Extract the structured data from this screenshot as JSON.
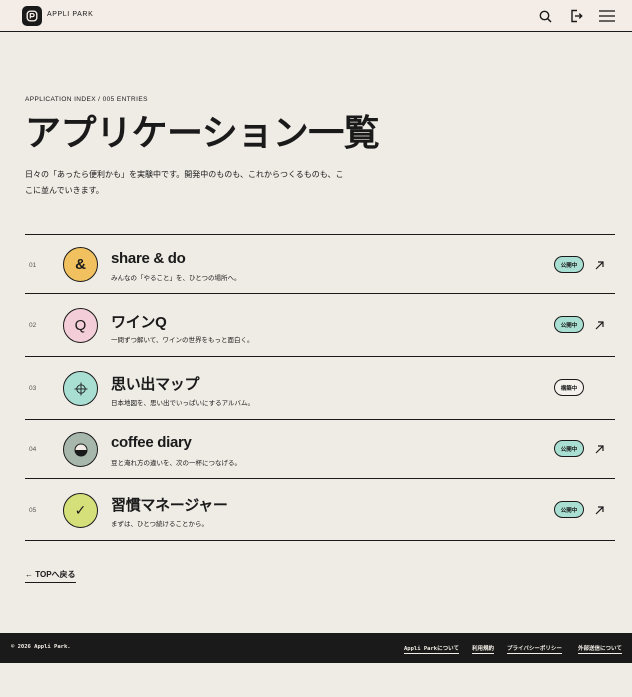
{
  "header": {
    "brand": "APPLI PARK",
    "icons": [
      "search-icon",
      "logout-icon",
      "menu-icon"
    ]
  },
  "hero": {
    "eyebrow": "APPLICATION INDEX / 005 ENTRIES",
    "title": "アプリケーション一覧",
    "intro": "日々の「あったら便利かも」を実験中です。開発中のものも、これからつくるものも、ここに並んでいきます。"
  },
  "apps": [
    {
      "num": "01",
      "icon": "&",
      "name": "share & do",
      "desc": "みんなの「やること」を、ひとつの場所へ。",
      "status": "公開中",
      "status_type": "public",
      "color": "#f2c15f"
    },
    {
      "num": "02",
      "icon": "Q",
      "name": "ワインQ",
      "desc": "一問ずつ解いて、ワインの世界をもっと面白く。",
      "status": "公開中",
      "status_type": "public",
      "color": "#f3cdd7"
    },
    {
      "num": "03",
      "icon": "crosshair",
      "name": "思い出マップ",
      "desc": "日本地図を、思い出でいっぱいにするアルバム。",
      "status": "構築中",
      "status_type": "dev",
      "color": "#a9dfd2"
    },
    {
      "num": "04",
      "icon": "half-circle",
      "name": "coffee diary",
      "desc": "豆と淹れ方の違いを、次の一杯につなげる。",
      "status": "公開中",
      "status_type": "public",
      "color": "#a8b7ac"
    },
    {
      "num": "05",
      "icon": "✓",
      "name": "習慣マネージャー",
      "desc": "まずは、ひとつ続けることから。",
      "status": "公開中",
      "status_type": "public",
      "color": "#d5e07a"
    }
  ],
  "back_link": "← TOPへ戻る",
  "footer": {
    "copyright": "© 2026 Appli Park.",
    "links": [
      "Appli Parkについて",
      "利用規約",
      "プライバシーポリシー",
      "外部送信について"
    ]
  }
}
